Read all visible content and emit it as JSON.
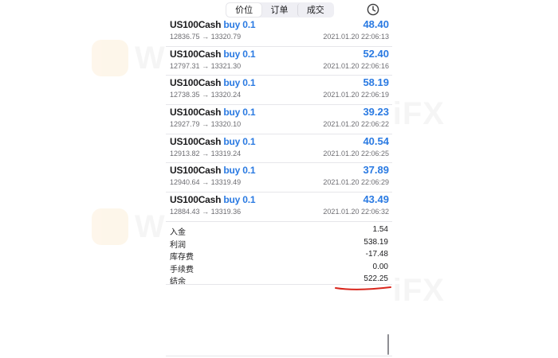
{
  "header": {
    "tabs": [
      {
        "label": "价位",
        "active": true
      },
      {
        "label": "订单",
        "active": false
      },
      {
        "label": "成交",
        "active": false
      }
    ],
    "history_icon": "clock-icon"
  },
  "deals": [
    {
      "symbol": "US100Cash",
      "side": "buy 0.1",
      "open": "12836.75",
      "close": "13320.79",
      "arrow": "→",
      "time": "2021.01.20 22:06:13",
      "profit": "48.40"
    },
    {
      "symbol": "US100Cash",
      "side": "buy 0.1",
      "open": "12797.31",
      "close": "13321.30",
      "arrow": "→",
      "time": "2021.01.20 22:06:16",
      "profit": "52.40"
    },
    {
      "symbol": "US100Cash",
      "side": "buy 0.1",
      "open": "12738.35",
      "close": "13320.24",
      "arrow": "→",
      "time": "2021.01.20 22:06:19",
      "profit": "58.19"
    },
    {
      "symbol": "US100Cash",
      "side": "buy 0.1",
      "open": "12927.79",
      "close": "13320.10",
      "arrow": "→",
      "time": "2021.01.20 22:06:22",
      "profit": "39.23"
    },
    {
      "symbol": "US100Cash",
      "side": "buy 0.1",
      "open": "12913.82",
      "close": "13319.24",
      "arrow": "→",
      "time": "2021.01.20 22:06:25",
      "profit": "40.54"
    },
    {
      "symbol": "US100Cash",
      "side": "buy 0.1",
      "open": "12940.64",
      "close": "13319.49",
      "arrow": "→",
      "time": "2021.01.20 22:06:29",
      "profit": "37.89"
    },
    {
      "symbol": "US100Cash",
      "side": "buy 0.1",
      "open": "12884.43",
      "close": "13319.36",
      "arrow": "→",
      "time": "2021.01.20 22:06:32",
      "profit": "43.49"
    }
  ],
  "summary": [
    {
      "label": "入金",
      "value": "1.54"
    },
    {
      "label": "利润",
      "value": "538.19"
    },
    {
      "label": "库存费",
      "value": "-17.48"
    },
    {
      "label": "手续费",
      "value": "0.00"
    },
    {
      "label": "结余",
      "value": "522.25"
    }
  ],
  "colors": {
    "accent": "#2a7ae2",
    "annotation": "#d9261c"
  },
  "watermark": {
    "text": "WikiFX"
  }
}
